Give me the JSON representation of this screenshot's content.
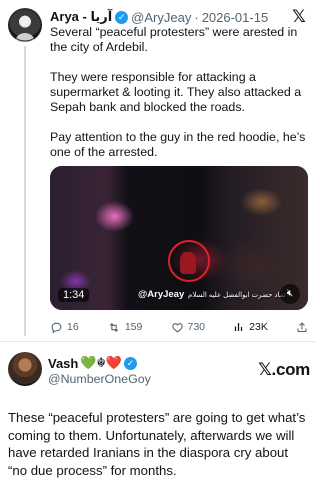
{
  "quoted_tweet": {
    "author_name": "Arya - آریا",
    "verified_badge": "✓",
    "handle": "@AryJeay",
    "separator": "·",
    "date": "2026-01-15",
    "platform_logo": "𝕏",
    "paragraphs": [
      "Several “peaceful protesters” were arested in the city of Ardebil.",
      "They were responsible for attacking a supermarket & looting it. They also attacked a Sepah bank and blocked the roads.",
      "Pay attention to the guy in the red hoodie, he’s one of the arrested."
    ],
    "video": {
      "duration": "1:34",
      "watermark": "@AryJeay",
      "watermark_arabic": "تماد حضرت ابوالفضل علیه السلام",
      "mute_icon": "speaker-muted-icon"
    },
    "actions": {
      "replies": "16",
      "reposts": "159",
      "likes": "730",
      "views": "23K"
    }
  },
  "reply": {
    "author_name": "Vash",
    "emoji": "💚☬❤️",
    "verified_badge": "✓",
    "handle": "@NumberOneGoy",
    "brand": "𝕏.com",
    "text": "These “peaceful protesters” are going to get what’s coming to them. Unfortunately, afterwards we will have retarded Iranians in the diaspora cry about “no due process” for months."
  },
  "colors": {
    "verified": "#1d9bf0",
    "muted_text": "#536471",
    "highlight_circle": "#e0202a"
  }
}
